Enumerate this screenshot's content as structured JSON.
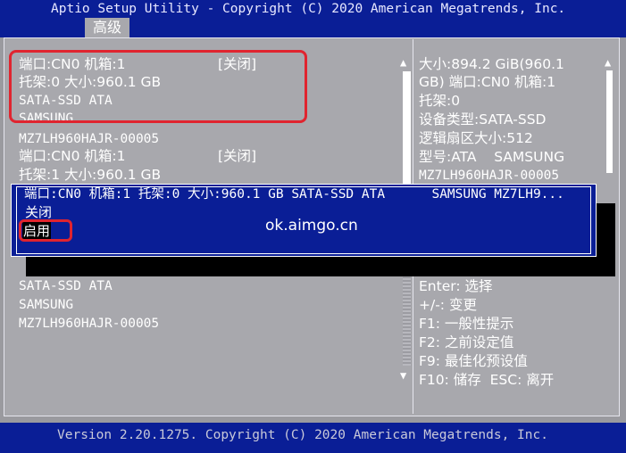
{
  "header": {
    "title": "Aptio Setup Utility - Copyright (C) 2020 American Megatrends, Inc.",
    "active_tab": "高级"
  },
  "left_list": [
    {
      "text": "端口:CN0 机箱:1",
      "value": "[关闭]"
    },
    {
      "text": "托架:0 大小:960.1 GB"
    },
    {
      "text": "SATA-SSD ATA"
    },
    {
      "text": "SAMSUNG"
    },
    {
      "text": "MZ7LH960HAJR-00005"
    },
    {
      "text": "端口:CN0 机箱:1",
      "value": "[关闭]"
    },
    {
      "text": "托架:1 大小:960.1 GB"
    },
    {
      "text": "SATA-SSD ATA"
    },
    {
      "text": "SAMSUNG"
    },
    {
      "text": "MZ7LH960HAJR-00005"
    }
  ],
  "popup": {
    "title": "端口:CN0 机箱:1 托架:0 大小:960.1 GB SATA-SSD ATA      SAMSUNG MZ7LH9...",
    "options": [
      "关闭",
      "启用"
    ],
    "selected": "启用"
  },
  "info_panel": {
    "lines": [
      "大小:894.2 GiB(960.1",
      "GB) 端口:CN0 机箱:1",
      "托架:0",
      "设备类型:SATA-SSD",
      "逻辑扇区大小:512",
      "型号:ATA    SAMSUNG",
      "MZ7LH960HAJR-00005"
    ]
  },
  "help_panel": {
    "lines": [
      "Enter: 选择",
      "+/-: 变更",
      "F1: 一般性提示",
      "F2: 之前设定值",
      "F9: 最佳化预设值",
      "F10: 储存  ESC: 离开"
    ]
  },
  "scroll": {
    "up": "▲",
    "down": "▼"
  },
  "watermark": "ok.aimgo.cn",
  "footer": {
    "version": "Version 2.20.1275. Copyright (C) 2020 American Megatrends, Inc."
  },
  "colors": {
    "bar_blue": "#0a1e96",
    "panel_gray": "#a8a8ad",
    "highlight_red": "#e0242f"
  }
}
